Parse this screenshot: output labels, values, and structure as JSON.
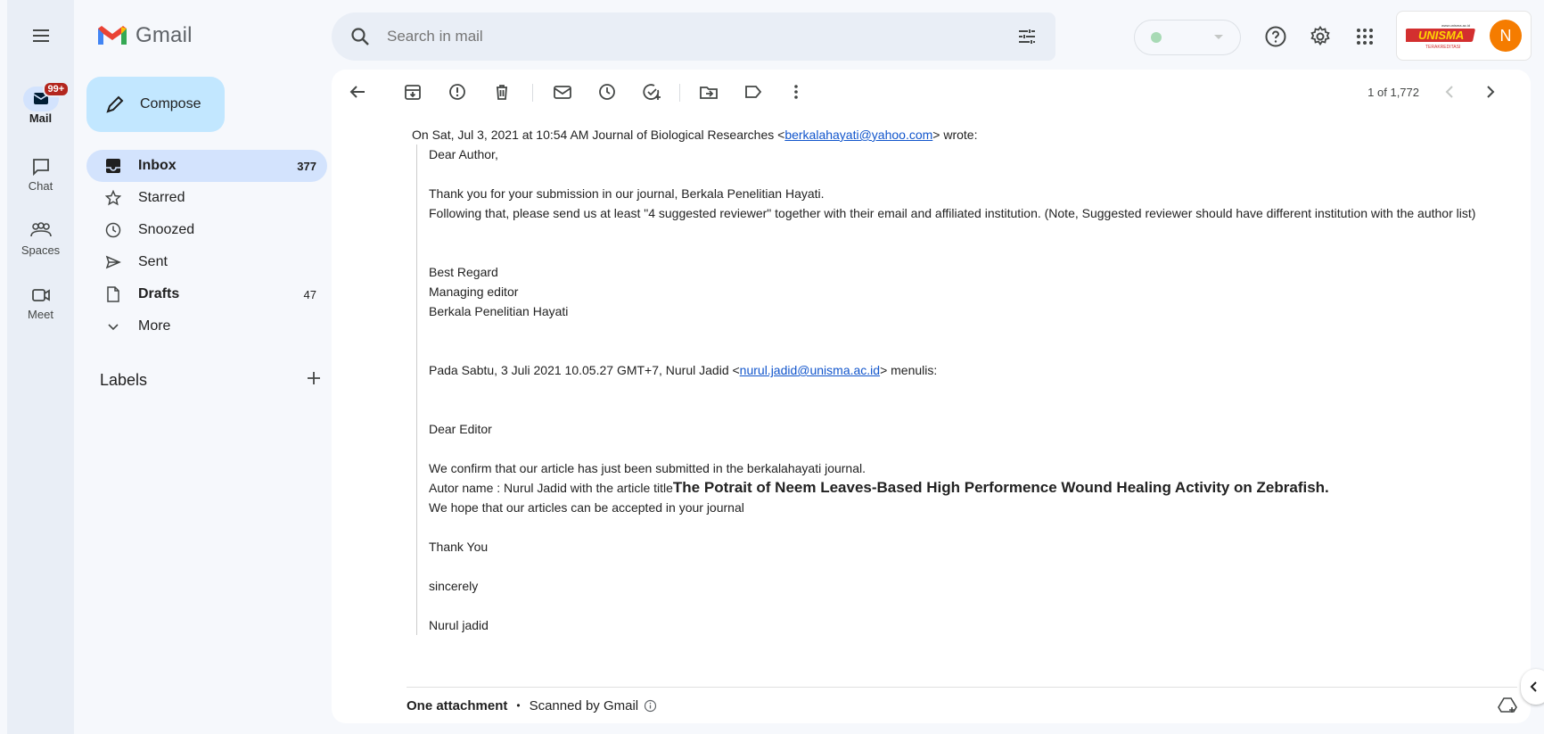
{
  "app": {
    "name": "Gmail"
  },
  "rail": {
    "items": [
      {
        "label": "Mail",
        "badge": "99+"
      },
      {
        "label": "Chat"
      },
      {
        "label": "Spaces"
      },
      {
        "label": "Meet"
      }
    ]
  },
  "sidebar": {
    "compose_label": "Compose",
    "items": [
      {
        "label": "Inbox",
        "count": "377"
      },
      {
        "label": "Starred",
        "count": ""
      },
      {
        "label": "Snoozed",
        "count": ""
      },
      {
        "label": "Sent",
        "count": ""
      },
      {
        "label": "Drafts",
        "count": "47"
      },
      {
        "label": "More",
        "count": ""
      }
    ],
    "labels_heading": "Labels"
  },
  "search": {
    "placeholder": "Search in mail"
  },
  "account": {
    "avatar_letter": "N",
    "logo_text": "UNISMA",
    "logo_subtext": "TERAKREDITASI",
    "logo_url": "www.unisma.ac.id"
  },
  "toolbar": {
    "pager": "1 of 1,772"
  },
  "email": {
    "wrote_line": {
      "prefix": "On Sat, Jul 3, 2021 at 10:54 AM Journal of Biological Researches <",
      "email": "berkalahayati@yahoo.com",
      "suffix": "> wrote:"
    },
    "q1": {
      "greeting": "Dear Author,",
      "p1": "Thank you for your submission in our journal, Berkala Penelitian Hayati.",
      "p2": "Following that, please send us at least \"4 suggested reviewer\" together with their email and affiliated institution. (Note, Suggested reviewer should have different institution with the author list)",
      "sig1": "Best Regard",
      "sig2": "Managing editor",
      "sig3": "Berkala Penelitian Hayati"
    },
    "menulis_line": {
      "prefix": "Pada Sabtu, 3 Juli 2021 10.05.27 GMT+7, Nurul Jadid <",
      "email": "nurul.jadid@unisma.ac.id",
      "suffix": "> menulis:"
    },
    "q2": {
      "greeting": "Dear Editor",
      "p1": "We confirm that our article has just been submitted in the berkalahayati journal.",
      "p2_prefix": "Autor name : Nurul Jadid with the article title",
      "p2_title": "The Potrait of Neem Leaves-Based High Performence Wound Healing Activity on Zebrafish.",
      "p3": "We hope that our articles can be accepted in your journal",
      "thanks": "Thank You",
      "closing": "sincerely",
      "name": "Nurul jadid"
    }
  },
  "attachments": {
    "label": "One attachment",
    "separator": "•",
    "scanned": "Scanned by Gmail"
  },
  "colors": {
    "accent": "#0b57d0",
    "compose_bg": "#c2e7ff",
    "active_nav": "#d3e3fd",
    "badge": "#b3261e",
    "avatar": "#f57c00"
  }
}
